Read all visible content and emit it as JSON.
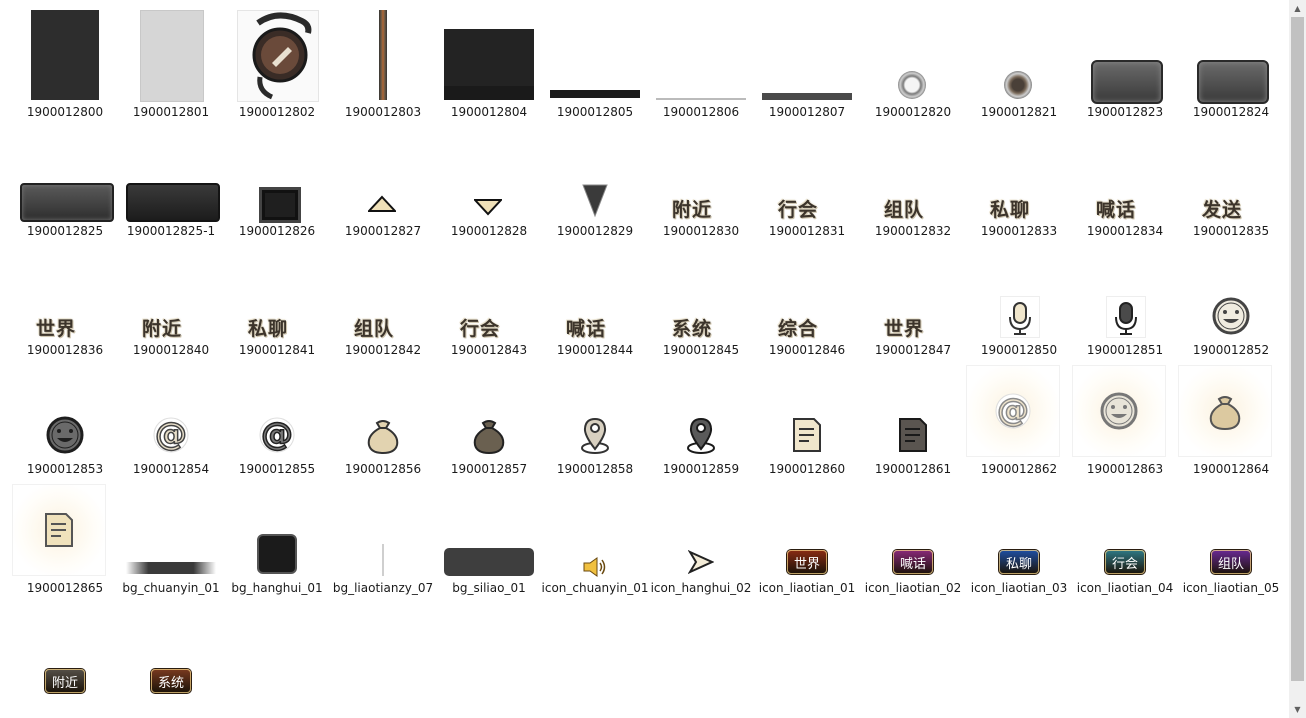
{
  "window": {
    "title": ""
  },
  "items": [
    {
      "label": "1900012800",
      "icon": "dark-gray-panel-icon"
    },
    {
      "label": "1900012801",
      "icon": "light-gray-panel-icon"
    },
    {
      "label": "1900012802",
      "icon": "ornate-round-emblem-icon"
    },
    {
      "label": "1900012803",
      "icon": "vertical-bar-icon"
    },
    {
      "label": "1900012804",
      "icon": "dark-rectangle-panel-icon"
    },
    {
      "label": "1900012805",
      "icon": "dark-strip-icon"
    },
    {
      "label": "1900012806",
      "icon": "thin-line-icon"
    },
    {
      "label": "1900012807",
      "icon": "gray-strip-icon"
    },
    {
      "label": "1900012820",
      "icon": "round-button-icon"
    },
    {
      "label": "1900012821",
      "icon": "round-button-dark-icon"
    },
    {
      "label": "1900012823",
      "icon": "stone-plate-icon"
    },
    {
      "label": "1900012824",
      "icon": "stone-plate-icon"
    },
    {
      "label": "1900012825",
      "icon": "stone-bar-icon"
    },
    {
      "label": "1900012825-1",
      "icon": "dark-stone-bar-icon"
    },
    {
      "label": "1900012826",
      "icon": "square-frame-icon"
    },
    {
      "label": "1900012827",
      "icon": "triangle-up-icon"
    },
    {
      "label": "1900012828",
      "icon": "triangle-down-icon"
    },
    {
      "label": "1900012829",
      "icon": "triangle-down-dark-icon"
    },
    {
      "label": "1900012830",
      "text": "附近"
    },
    {
      "label": "1900012831",
      "text": "行会"
    },
    {
      "label": "1900012832",
      "text": "组队"
    },
    {
      "label": "1900012833",
      "text": "私聊"
    },
    {
      "label": "1900012834",
      "text": "喊话"
    },
    {
      "label": "1900012835",
      "text": "发送"
    },
    {
      "label": "1900012836",
      "text": "世界"
    },
    {
      "label": "1900012840",
      "text": "附近"
    },
    {
      "label": "1900012841",
      "text": "私聊"
    },
    {
      "label": "1900012842",
      "text": "组队"
    },
    {
      "label": "1900012843",
      "text": "行会"
    },
    {
      "label": "1900012844",
      "text": "喊话"
    },
    {
      "label": "1900012845",
      "text": "系统"
    },
    {
      "label": "1900012846",
      "text": "综合"
    },
    {
      "label": "1900012847",
      "text": "世界"
    },
    {
      "label": "1900012850",
      "icon": "microphone-icon"
    },
    {
      "label": "1900012851",
      "icon": "microphone-dark-icon"
    },
    {
      "label": "1900012852",
      "icon": "smiley-icon"
    },
    {
      "label": "1900012853",
      "icon": "smiley-dark-icon"
    },
    {
      "label": "1900012854",
      "icon": "at-sign-icon"
    },
    {
      "label": "1900012855",
      "icon": "at-sign-dark-icon"
    },
    {
      "label": "1900012856",
      "icon": "money-bag-icon"
    },
    {
      "label": "1900012857",
      "icon": "money-bag-dark-icon"
    },
    {
      "label": "1900012858",
      "icon": "location-pin-icon"
    },
    {
      "label": "1900012859",
      "icon": "location-pin-dark-icon"
    },
    {
      "label": "1900012860",
      "icon": "document-icon"
    },
    {
      "label": "1900012861",
      "icon": "document-dark-icon"
    },
    {
      "label": "1900012862",
      "icon": "at-sign-glow-icon"
    },
    {
      "label": "1900012863",
      "icon": "smiley-glow-icon"
    },
    {
      "label": "1900012864",
      "icon": "money-bag-glow-icon"
    },
    {
      "label": "1900012865",
      "icon": "document-glow-icon"
    },
    {
      "label": "bg_chuanyin_01",
      "icon": "gradient-bar-icon"
    },
    {
      "label": "bg_hanghui_01",
      "icon": "black-rounded-square-icon"
    },
    {
      "label": "bg_liaotianzy_07",
      "icon": "thin-vertical-line-icon"
    },
    {
      "label": "bg_siliao_01",
      "icon": "dark-rounded-bar-icon"
    },
    {
      "label": "icon_chuanyin_01",
      "icon": "speaker-icon"
    },
    {
      "label": "icon_hanghui_02",
      "icon": "arrow-cursor-icon"
    },
    {
      "label": "icon_liaotian_01",
      "btn": "世界",
      "color": "#8a2c14"
    },
    {
      "label": "icon_liaotian_02",
      "btn": "喊话",
      "color": "#8a2a7a"
    },
    {
      "label": "icon_liaotian_03",
      "btn": "私聊",
      "color": "#1f4fa3"
    },
    {
      "label": "icon_liaotian_04",
      "btn": "行会",
      "color": "#2f7a86"
    },
    {
      "label": "icon_liaotian_05",
      "btn": "组队",
      "color": "#6a2a94"
    },
    {
      "label": "",
      "btn": "附近",
      "color": "#555048"
    },
    {
      "label": "",
      "btn": "系统",
      "color": "#7a3a20"
    }
  ]
}
